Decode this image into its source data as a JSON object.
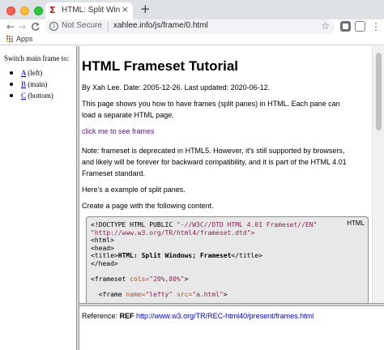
{
  "browser": {
    "tab_favicon": "Σ",
    "tab_title": "HTML: Split Windows; Frameset",
    "tab_close": "×",
    "new_tab": "+",
    "back": "←",
    "forward": "→",
    "reload": "C",
    "security_label": "Not Secure",
    "url": "xahlee.info/js/frame/0.html",
    "bookmark_star": "☆",
    "menu": "⋮",
    "bookmarks_bar": {
      "apps_label": "Apps"
    }
  },
  "left_frame": {
    "heading": "Switch main frame to:",
    "items": [
      {
        "link": "A",
        "suffix": " (left)"
      },
      {
        "link": "B",
        "suffix": " (main)"
      },
      {
        "link": "C",
        "suffix": " (bottom)"
      }
    ]
  },
  "main_frame": {
    "title": "HTML Frameset Tutorial",
    "byline": "By Xah Lee. Date: 2005-12-26. Last updated: 2020-06-12.",
    "intro": "This page shows you how to have frames (split panes) in HTML. Each pane can load a separate HTML page.",
    "frames_link": "click me to see frames",
    "note": "Note: frameset is deprecated in HTML5. However, it's still supported by browsers, and likely will be forever for backward compatibility, and it is part of the HTML 4.01 Frameset standard.",
    "example_intro": "Here's a example of split panes.",
    "create_intro": "Create a page with the following content.",
    "code": {
      "lang": "HTML",
      "doctype": "<!DOCTYPE HTML PUBLIC ",
      "doctype_str": "\"-//W3C//DTD HTML 4.01 Frameset//EN\"",
      "dtd_url": "\"http://www.w3.org/TR/html4/frameset.dtd\">",
      "html_open": "<html>",
      "head_open": "<head>",
      "title_open": "<title>",
      "title_text": "HTML: Split Windows; Frameset",
      "title_close": "</title>",
      "head_close": "</head>",
      "frameset_open": "<frameset ",
      "frameset_attr": "cols=",
      "frameset_val": "\"20%,80%\"",
      "frameset_end": ">",
      "frame_open": "  <frame ",
      "frame_name_attr": "name=",
      "frame_name_val": "\"lefty\"",
      "frame_src_attr": " src=",
      "frame_src_val": "\"a.html\"",
      "frame_end": ">"
    }
  },
  "bottom_frame": {
    "reference_label": "Reference: ",
    "ref_tag": "REF",
    "ref_url": "http://www.w3.org/TR/REC-html40/present/frames.html"
  },
  "colors": {
    "chrome_bg": "#dee1e6",
    "link": "#0000ee",
    "visited_link": "#551a8b",
    "code_bg": "#e8e8e8"
  }
}
